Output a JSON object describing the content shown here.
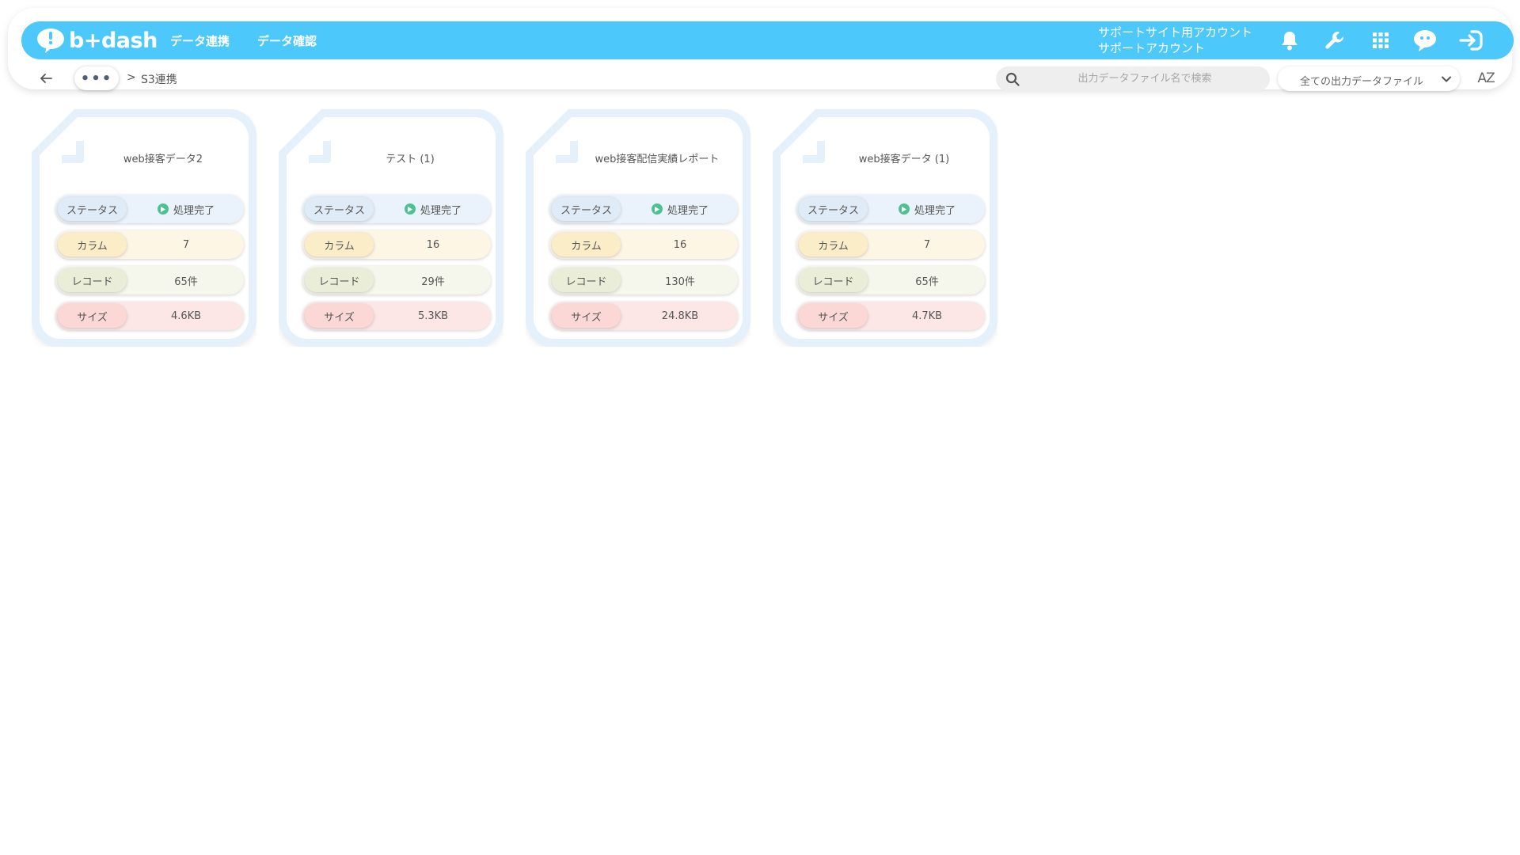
{
  "header": {
    "logo_text": "b+dash",
    "nav": [
      "データ連携",
      "データ確認"
    ],
    "account_line1": "サポートサイト用アカウント",
    "account_line2": "サポートアカウント",
    "icons": [
      "bell-icon",
      "wrench-icon",
      "apps-grid-icon",
      "mascot-icon",
      "logout-icon"
    ],
    "accent_color": "#4cc8fb"
  },
  "toolbar": {
    "more_label": "•••",
    "separator": ">",
    "current": "S3連携",
    "search_placeholder": "出力データファイル名で検索",
    "filter_label": "全ての出力データファイル",
    "sort_label": "AZ"
  },
  "labels": {
    "status": "ステータス",
    "column": "カラム",
    "record": "レコード",
    "size": "サイズ"
  },
  "cards": [
    {
      "title": "web接客データ2",
      "status": "処理完了",
      "columns": "7",
      "records": "65件",
      "size": "4.6KB"
    },
    {
      "title": "テスト (1)",
      "status": "処理完了",
      "columns": "16",
      "records": "29件",
      "size": "5.3KB"
    },
    {
      "title": "web接客配信実績レポート",
      "status": "処理完了",
      "columns": "16",
      "records": "130件",
      "size": "24.8KB"
    },
    {
      "title": "web接客データ (1)",
      "status": "処理完了",
      "columns": "7",
      "records": "65件",
      "size": "4.7KB"
    }
  ]
}
